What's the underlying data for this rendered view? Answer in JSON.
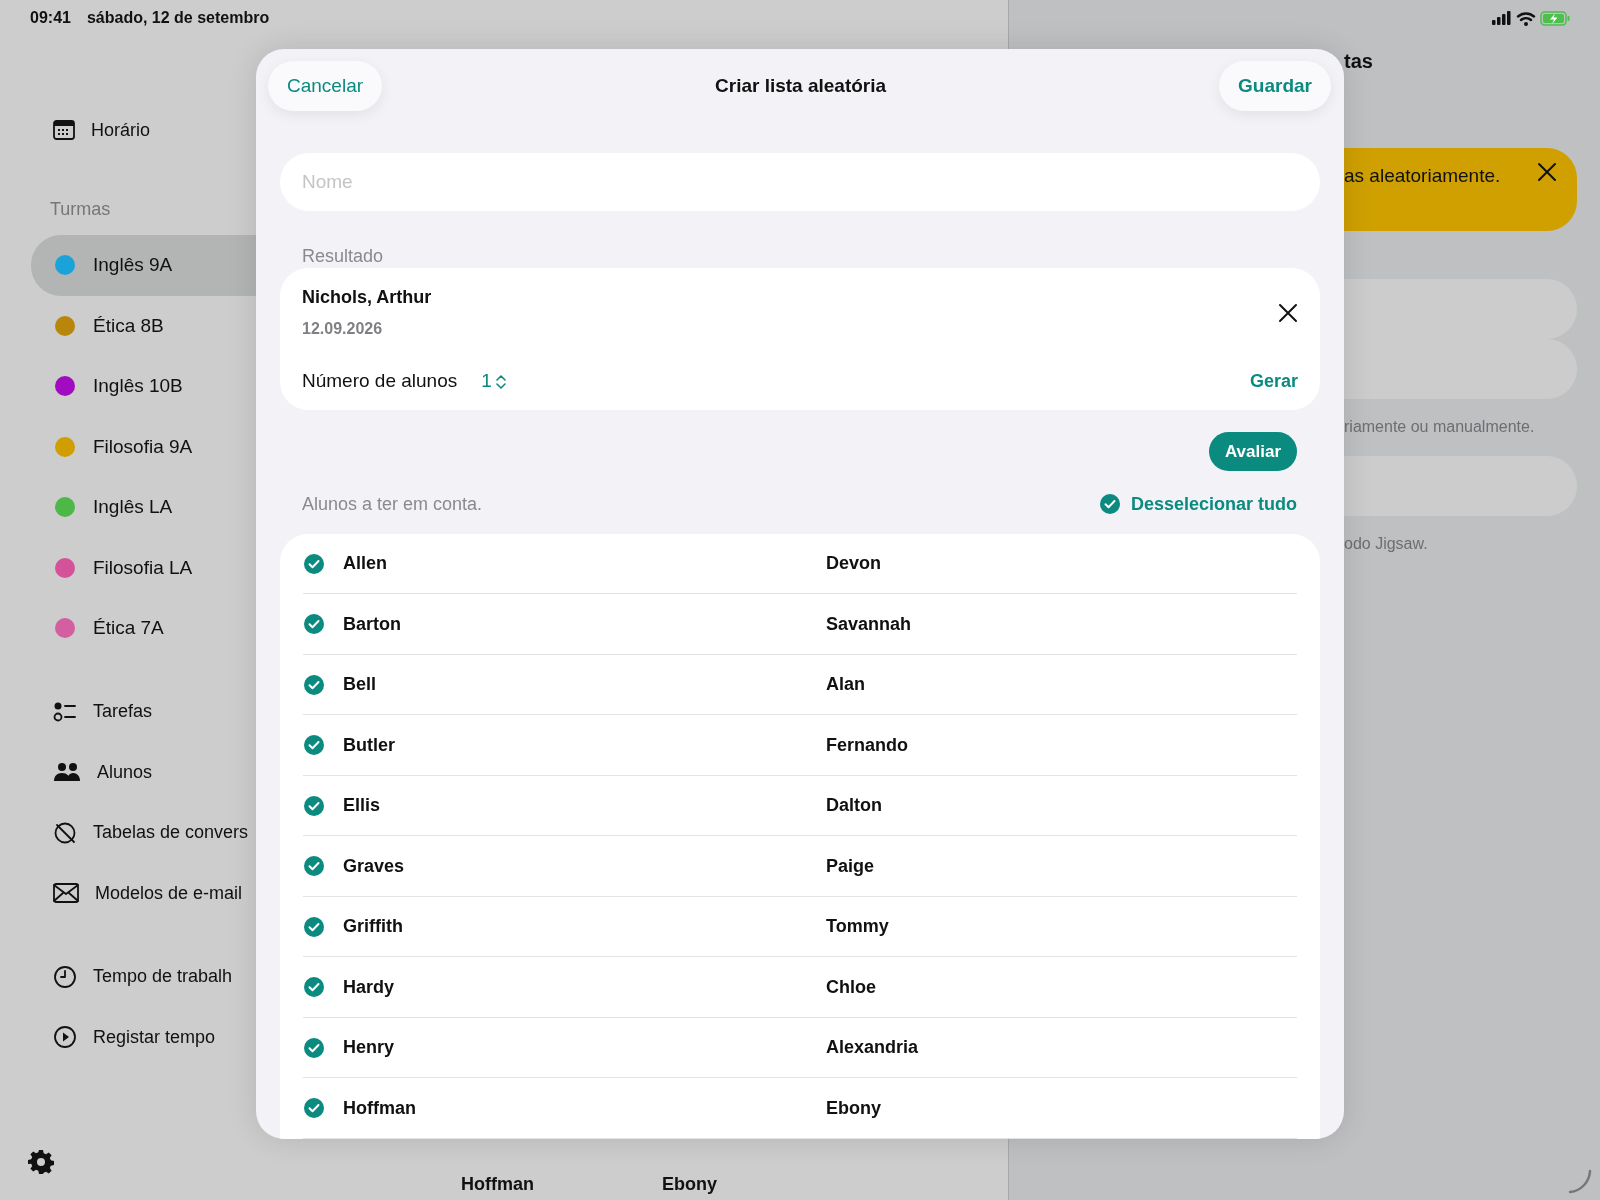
{
  "status_bar": {
    "time": "09:41",
    "date": "sábado, 12 de setembro"
  },
  "sidebar": {
    "top_items": [
      {
        "label": "Horário"
      }
    ],
    "section_title": "Turmas",
    "classes": [
      {
        "label": "Inglês 9A",
        "color": "#1aa3d9",
        "selected": true
      },
      {
        "label": "Ética 8B",
        "color": "#b8860b",
        "selected": false
      },
      {
        "label": "Inglês 10B",
        "color": "#a10cc0",
        "selected": false
      },
      {
        "label": "Filosofia 9A",
        "color": "#d09e00",
        "selected": false
      },
      {
        "label": "Inglês LA",
        "color": "#4db848",
        "selected": false
      },
      {
        "label": "Filosofia LA",
        "color": "#d4529a",
        "selected": false
      },
      {
        "label": "Ética 7A",
        "color": "#d45fa0",
        "selected": false
      }
    ],
    "tool_items": [
      {
        "label": "Tarefas"
      },
      {
        "label": "Alunos"
      },
      {
        "label": "Tabelas de convers"
      },
      {
        "label": "Modelos de e-mail"
      }
    ],
    "time_items": [
      {
        "label": "Tempo de trabalh"
      },
      {
        "label": "Registar tempo"
      }
    ]
  },
  "background_list_row": [
    "Hoffman",
    "Ebony"
  ],
  "right_pane": {
    "title": "tas",
    "banner": "as aleatoriamente.",
    "captions": [
      "riamente ou manualmente.",
      "odo Jigsaw."
    ]
  },
  "dialog": {
    "cancel": "Cancelar",
    "title": "Criar lista aleatória",
    "save": "Guardar",
    "name_field": {
      "placeholder": "Nome"
    },
    "result_label": "Resultado",
    "result": {
      "name": "Nichols, Arthur",
      "date": "12.09.2026",
      "count_label": "Número de alunos",
      "count": "1",
      "generate": "Gerar"
    },
    "evaluate": "Avaliar",
    "students_label": "Alunos a ter em conta.",
    "deselect_all": "Desselecionar tudo",
    "students": [
      {
        "last": "Allen",
        "first": "Devon",
        "checked": true
      },
      {
        "last": "Barton",
        "first": "Savannah",
        "checked": true
      },
      {
        "last": "Bell",
        "first": "Alan",
        "checked": true
      },
      {
        "last": "Butler",
        "first": "Fernando",
        "checked": true
      },
      {
        "last": "Ellis",
        "first": "Dalton",
        "checked": true
      },
      {
        "last": "Graves",
        "first": "Paige",
        "checked": true
      },
      {
        "last": "Griffith",
        "first": "Tommy",
        "checked": true
      },
      {
        "last": "Hardy",
        "first": "Chloe",
        "checked": true
      },
      {
        "last": "Henry",
        "first": "Alexandria",
        "checked": true
      },
      {
        "last": "Hoffman",
        "first": "Ebony",
        "checked": true
      }
    ]
  }
}
